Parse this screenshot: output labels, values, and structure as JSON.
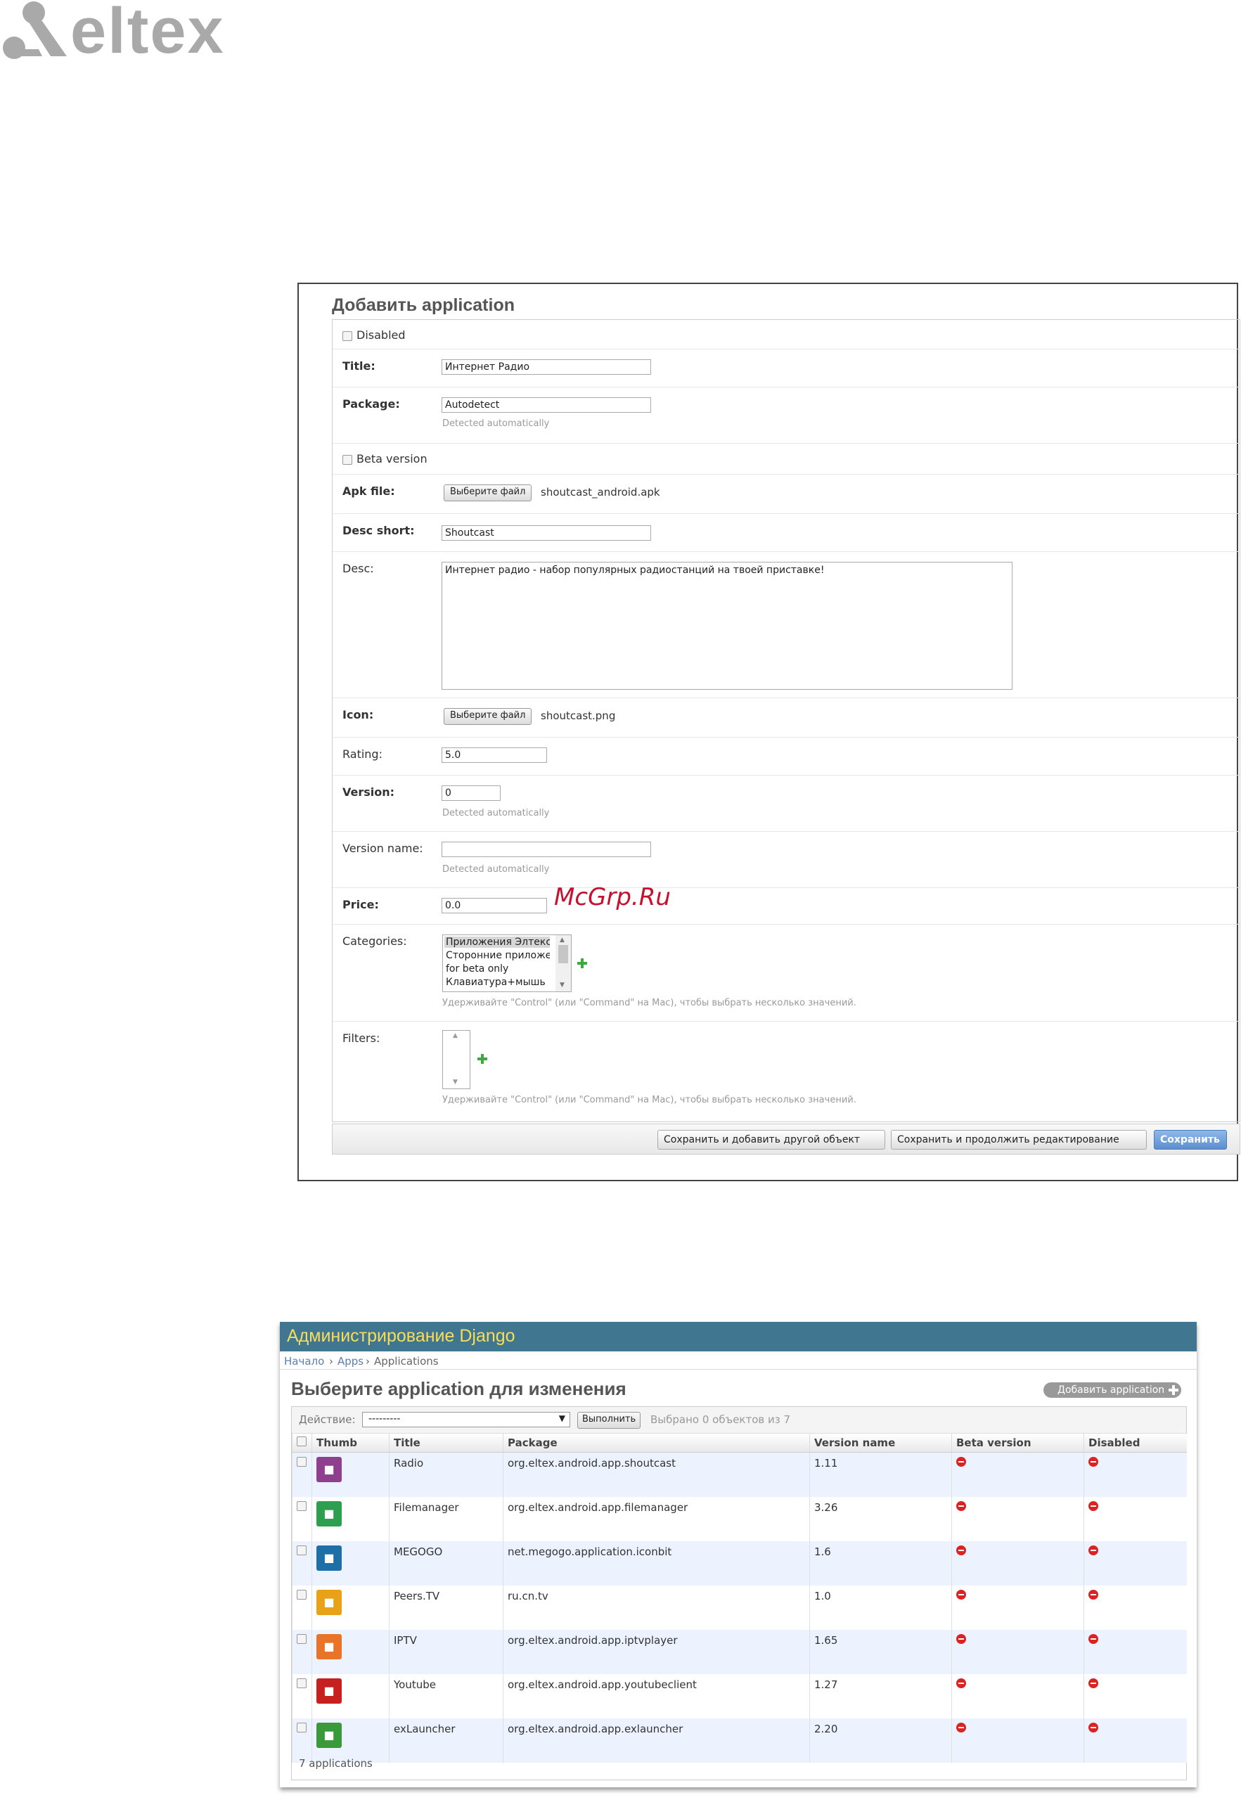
{
  "logo": {
    "text": "eltex"
  },
  "watermark": "McGrp.Ru",
  "add_form": {
    "title": "Добавить application",
    "disabled_label": "Disabled",
    "title_label": "Title:",
    "title_value": "Интернет Радио",
    "package_label": "Package:",
    "package_value": "Autodetect",
    "package_help": "Detected automatically",
    "beta_label": "Beta version",
    "apk_label": "Apk file:",
    "apk_button": "Выберите файл",
    "apk_file": "shoutcast_android.apk",
    "desc_short_label": "Desc short:",
    "desc_short_value": "Shoutcast",
    "desc_label": "Desc:",
    "desc_value": "Интернет радио - набор популярных радиостанций на твоей приставке!",
    "icon_label": "Icon:",
    "icon_button": "Выберите файл",
    "icon_file": "shoutcast.png",
    "rating_label": "Rating:",
    "rating_value": "5.0",
    "version_label": "Version:",
    "version_value": "0",
    "version_help": "Detected automatically",
    "version_name_label": "Version name:",
    "version_name_value": "",
    "version_name_help": "Detected automatically",
    "price_label": "Price:",
    "price_value": "0.0",
    "categories_label": "Categories:",
    "categories_options": [
      "Приложения Элтекс",
      "Сторонние приложения",
      "for beta only",
      "Клавиатура+мышь"
    ],
    "categories_help": "Удерживайте \"Control\" (или \"Command\" на Mac), чтобы выбрать несколько значений.",
    "filters_label": "Filters:",
    "filters_help": "Удерживайте \"Control\" (или \"Command\" на Mac), чтобы выбрать несколько значений.",
    "btn_save_add": "Сохранить и добавить другой объект",
    "btn_save_continue": "Сохранить и продолжить редактирование",
    "btn_save": "Сохранить"
  },
  "change_list": {
    "site_title": "Администрирование Django",
    "breadcrumb": [
      "Начало",
      "Apps",
      "Applications"
    ],
    "title": "Выберите application для изменения",
    "add_button": "Добавить application",
    "action_label": "Действие:",
    "action_value": "---------",
    "action_go": "Выполнить",
    "selection_count": "Выбрано 0 объектов из 7",
    "columns": [
      "Thumb",
      "Title",
      "Package",
      "Version name",
      "Beta version",
      "Disabled"
    ],
    "rows": [
      {
        "title": "Radio",
        "package": "org.eltex.android.app.shoutcast",
        "version": "1.11",
        "thumb_color": "#8e3f8e",
        "thumb_icon": "radio-icon"
      },
      {
        "title": "Filemanager",
        "package": "org.eltex.android.app.filemanager",
        "version": "3.26",
        "thumb_color": "#2e9e4f",
        "thumb_icon": "folder-icon"
      },
      {
        "title": "MEGOGO",
        "package": "net.megogo.application.iconbit",
        "version": "1.6",
        "thumb_color": "#1e6fa8",
        "thumb_icon": "play-icon"
      },
      {
        "title": "Peers.TV",
        "package": "ru.cn.tv",
        "version": "1.0",
        "thumb_color": "#e8a21a",
        "thumb_icon": "tv-icon"
      },
      {
        "title": "IPTV",
        "package": "org.eltex.android.app.iptvplayer",
        "version": "1.65",
        "thumb_color": "#e8742a",
        "thumb_icon": "monitor-icon"
      },
      {
        "title": "Youtube",
        "package": "org.eltex.android.app.youtubeclient",
        "version": "1.27",
        "thumb_color": "#c8201e",
        "thumb_icon": "youtube-icon"
      },
      {
        "title": "exLauncher",
        "package": "org.eltex.android.app.exlauncher",
        "version": "2.20",
        "thumb_color": "#3a9a3a",
        "thumb_icon": "grid-icon"
      }
    ],
    "footer": "7 applications"
  }
}
